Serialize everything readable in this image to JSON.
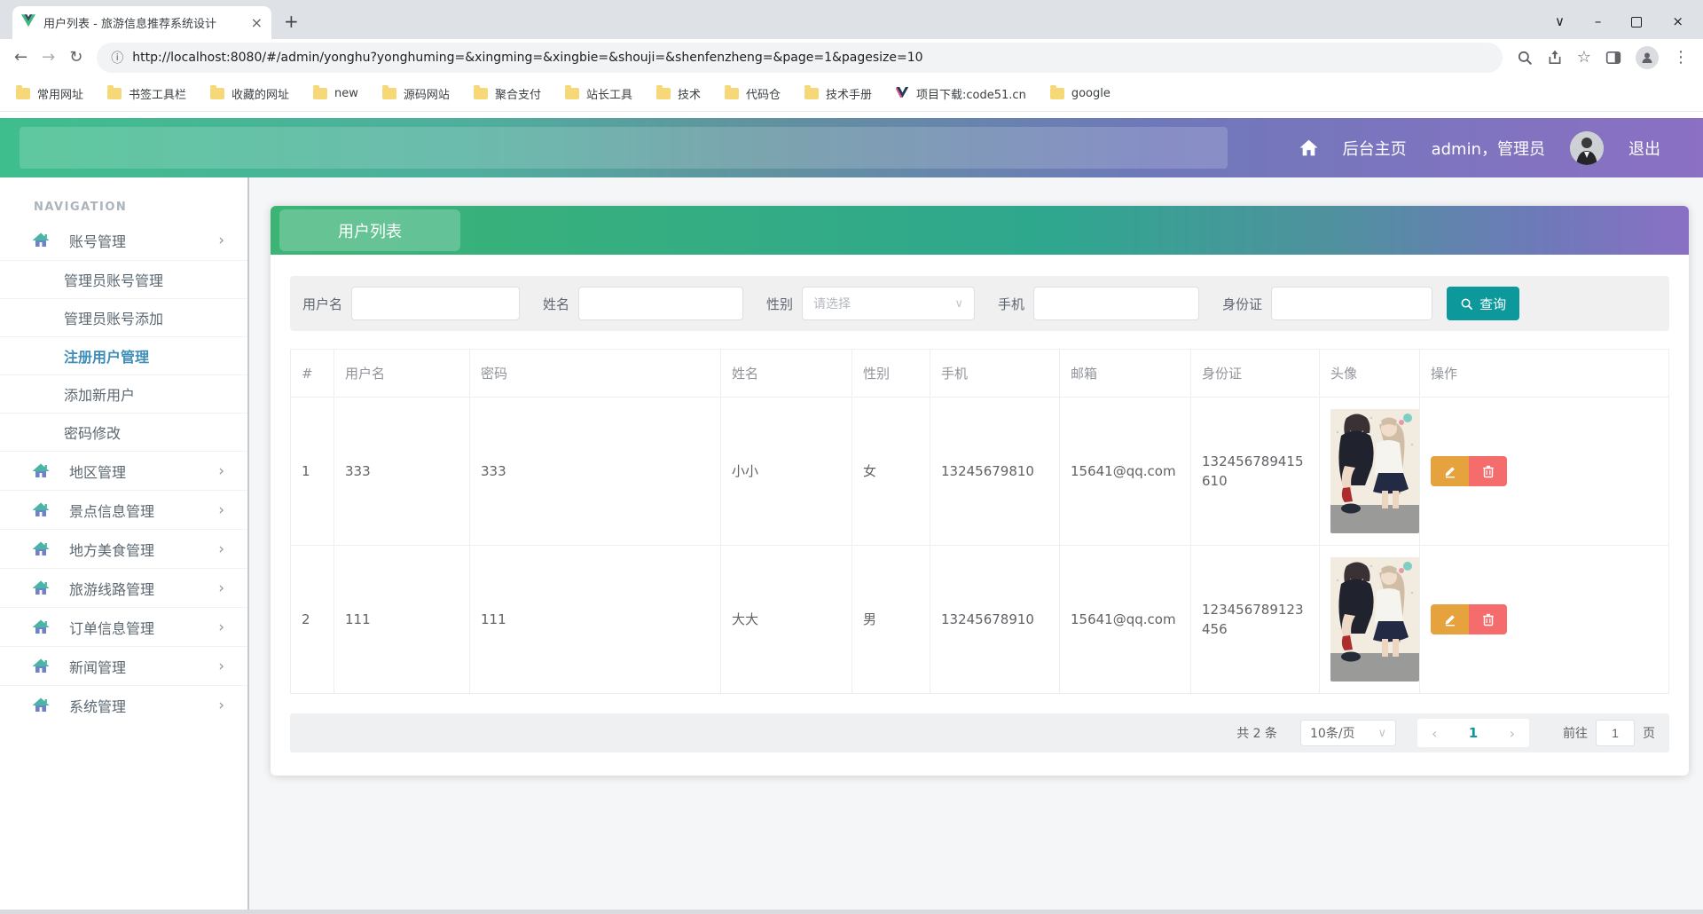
{
  "browser": {
    "tab_title": "用户列表 - 旅游信息推荐系统设计",
    "url": "http://localhost:8080/#/admin/yonghu?yonghuming=&xingming=&xingbie=&shouji=&shenfenzheng=&page=1&pagesize=10",
    "bookmarks": [
      {
        "label": "常用网址"
      },
      {
        "label": "书签工具栏"
      },
      {
        "label": "收藏的网址"
      },
      {
        "label": "new"
      },
      {
        "label": "源码网站"
      },
      {
        "label": "聚合支付"
      },
      {
        "label": "站长工具"
      },
      {
        "label": "技术"
      },
      {
        "label": "代码仓"
      },
      {
        "label": "技术手册"
      },
      {
        "label": "项目下载:code51.cn"
      },
      {
        "label": "google"
      }
    ]
  },
  "icons": {
    "back": "←",
    "forward": "→",
    "reload": "↻",
    "info": "ⓘ",
    "star": "☆",
    "dots": "⋮",
    "tab_search": "∨",
    "minimize": "–",
    "close": "×",
    "plus": "+",
    "chevron_right": "›",
    "chevron_down": "∨",
    "prev": "‹",
    "next": "›"
  },
  "header": {
    "nav_home": "后台主页",
    "user": "admin，管理员",
    "logout": "退出"
  },
  "sidebar": {
    "section": "NAVIGATION",
    "account_menu": {
      "label": "账号管理"
    },
    "account_children": [
      {
        "label": "管理员账号管理",
        "active": false
      },
      {
        "label": "管理员账号添加",
        "active": false
      },
      {
        "label": "注册用户管理",
        "active": true
      },
      {
        "label": "添加新用户",
        "active": false
      },
      {
        "label": "密码修改",
        "active": false
      }
    ],
    "menus": [
      {
        "label": "地区管理"
      },
      {
        "label": "景点信息管理"
      },
      {
        "label": "地方美食管理"
      },
      {
        "label": "旅游线路管理"
      },
      {
        "label": "订单信息管理"
      },
      {
        "label": "新闻管理"
      },
      {
        "label": "系统管理"
      }
    ]
  },
  "main": {
    "card_title": "用户列表",
    "filter": {
      "username_label": "用户名",
      "name_label": "姓名",
      "gender_label": "性别",
      "gender_placeholder": "请选择",
      "phone_label": "手机",
      "idcard_label": "身份证",
      "search_label": "查询"
    },
    "table": {
      "columns": [
        "#",
        "用户名",
        "密码",
        "姓名",
        "性别",
        "手机",
        "邮箱",
        "身份证",
        "头像",
        "操作"
      ],
      "rows": [
        {
          "index": "1",
          "username": "333",
          "password": "333",
          "name": "小小",
          "gender": "女",
          "phone": "13245679810",
          "email": "15641@qq.com",
          "idcard": "132456789415610"
        },
        {
          "index": "2",
          "username": "111",
          "password": "111",
          "name": "大大",
          "gender": "男",
          "phone": "13245678910",
          "email": "15641@qq.com",
          "idcard": "123456789123456"
        }
      ]
    },
    "pagination": {
      "total": "共 2 条",
      "page_size": "10条/页",
      "current": "1",
      "goto_label": "前往",
      "goto_value": "1",
      "unit_label": "页"
    }
  },
  "colors": {
    "accent_teal": "#0d989c",
    "edit_orange": "#e6a23c",
    "delete_red": "#f56c6c",
    "sidebar_active": "#3d8eb9",
    "header_gradient_start": "#3fbe8d",
    "header_gradient_end": "#8b70c3"
  }
}
